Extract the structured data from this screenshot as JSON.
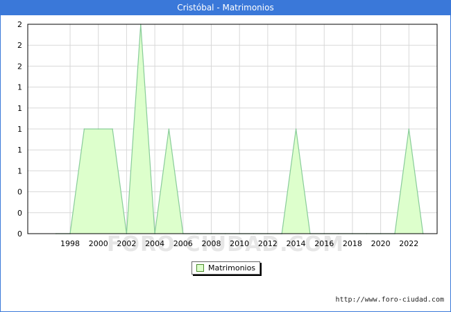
{
  "title": "Cristóbal - Matrimonios",
  "legend_label": "Matrimonios",
  "source": "http://www.foro-ciudad.com",
  "watermark": "FORO-CIUDAD.COM",
  "colors": {
    "header": "#3a78d9",
    "fill": "#ddffcc",
    "line": "#88cc99",
    "grid": "#d8d8d8"
  },
  "chart_data": {
    "type": "area",
    "title": "Cristóbal - Matrimonios",
    "xlabel": "",
    "ylabel": "",
    "x": [
      1997,
      1998,
      1999,
      2000,
      2001,
      2002,
      2003,
      2004,
      2005,
      2006,
      2007,
      2008,
      2009,
      2010,
      2011,
      2012,
      2013,
      2014,
      2015,
      2016,
      2017,
      2018,
      2019,
      2020,
      2021,
      2022,
      2023
    ],
    "series": [
      {
        "name": "Matrimonios",
        "values": [
          0,
          0,
          1,
          1,
          1,
          0,
          2,
          0,
          1,
          0,
          0,
          0,
          0,
          0,
          0,
          0,
          0,
          1,
          0,
          0,
          0,
          0,
          0,
          0,
          0,
          1,
          0
        ]
      }
    ],
    "x_ticks": [
      "1998",
      "2000",
      "2002",
      "2004",
      "2006",
      "2008",
      "2010",
      "2012",
      "2014",
      "2016",
      "2018",
      "2020",
      "2022"
    ],
    "y_tick_labels": [
      "0",
      "0",
      "0",
      "1",
      "1",
      "1",
      "1",
      "1",
      "2",
      "2",
      "2"
    ],
    "xlim": [
      1995,
      2024
    ],
    "ylim": [
      0,
      2
    ],
    "grid": true,
    "legend": "bottom-center"
  }
}
